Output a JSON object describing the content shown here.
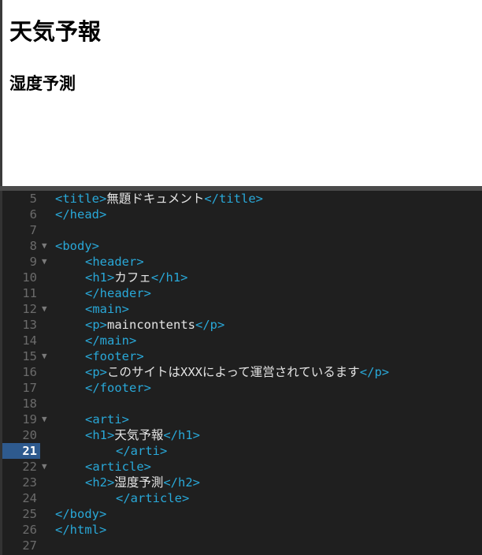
{
  "preview": {
    "h1": "天気予報",
    "h2": "湿度予測"
  },
  "editor": {
    "active_line": 21,
    "lines": [
      {
        "n": "5",
        "fold": false,
        "indent": 0,
        "tokens": [
          [
            "tag",
            "<title>"
          ],
          [
            "txt",
            "無題ドキュメント"
          ],
          [
            "tag",
            "</title>"
          ]
        ]
      },
      {
        "n": "6",
        "fold": false,
        "indent": 0,
        "tokens": [
          [
            "tag",
            "</head>"
          ]
        ]
      },
      {
        "n": "7",
        "fold": false,
        "indent": 0,
        "tokens": []
      },
      {
        "n": "8",
        "fold": true,
        "indent": 0,
        "tokens": [
          [
            "tag",
            "<body>"
          ]
        ]
      },
      {
        "n": "9",
        "fold": true,
        "indent": 1,
        "tokens": [
          [
            "tag",
            "<header>"
          ]
        ]
      },
      {
        "n": "10",
        "fold": false,
        "indent": 1,
        "tokens": [
          [
            "tag",
            "<h1>"
          ],
          [
            "txt",
            "カフェ"
          ],
          [
            "tag",
            "</h1>"
          ]
        ]
      },
      {
        "n": "11",
        "fold": false,
        "indent": 1,
        "tokens": [
          [
            "tag",
            "</header>"
          ]
        ]
      },
      {
        "n": "12",
        "fold": true,
        "indent": 1,
        "tokens": [
          [
            "tag",
            "<main>"
          ]
        ]
      },
      {
        "n": "13",
        "fold": false,
        "indent": 1,
        "tokens": [
          [
            "tag",
            "<p>"
          ],
          [
            "txt",
            "maincontents"
          ],
          [
            "tag",
            "</p>"
          ]
        ]
      },
      {
        "n": "14",
        "fold": false,
        "indent": 1,
        "tokens": [
          [
            "tag",
            "</main>"
          ]
        ]
      },
      {
        "n": "15",
        "fold": true,
        "indent": 1,
        "tokens": [
          [
            "tag",
            "<footer>"
          ]
        ]
      },
      {
        "n": "16",
        "fold": false,
        "indent": 1,
        "tokens": [
          [
            "tag",
            "<p>"
          ],
          [
            "txt",
            "このサイトはXXXによって運営されているます"
          ],
          [
            "tag",
            "</p>"
          ]
        ]
      },
      {
        "n": "17",
        "fold": false,
        "indent": 1,
        "tokens": [
          [
            "tag",
            "</footer>"
          ]
        ]
      },
      {
        "n": "18",
        "fold": false,
        "indent": 0,
        "tokens": []
      },
      {
        "n": "19",
        "fold": true,
        "indent": 1,
        "tokens": [
          [
            "tag",
            "<arti>"
          ]
        ]
      },
      {
        "n": "20",
        "fold": false,
        "indent": 1,
        "tokens": [
          [
            "tag",
            "<h1>"
          ],
          [
            "txt",
            "天気予報"
          ],
          [
            "tag",
            "</h1>"
          ]
        ]
      },
      {
        "n": "21",
        "fold": false,
        "indent": 2,
        "tokens": [
          [
            "tag",
            "</arti>"
          ]
        ]
      },
      {
        "n": "22",
        "fold": true,
        "indent": 1,
        "tokens": [
          [
            "tag",
            "<article>"
          ]
        ]
      },
      {
        "n": "23",
        "fold": false,
        "indent": 1,
        "tokens": [
          [
            "tag",
            "<h2>"
          ],
          [
            "txt",
            "湿度予測"
          ],
          [
            "tag",
            "</h2>"
          ]
        ]
      },
      {
        "n": "24",
        "fold": false,
        "indent": 2,
        "tokens": [
          [
            "tag",
            "</article>"
          ]
        ]
      },
      {
        "n": "25",
        "fold": false,
        "indent": 0,
        "tokens": [
          [
            "tag",
            "</body>"
          ]
        ]
      },
      {
        "n": "26",
        "fold": false,
        "indent": 0,
        "tokens": [
          [
            "tag",
            "</html>"
          ]
        ]
      },
      {
        "n": "27",
        "fold": false,
        "indent": 0,
        "tokens": []
      }
    ]
  }
}
